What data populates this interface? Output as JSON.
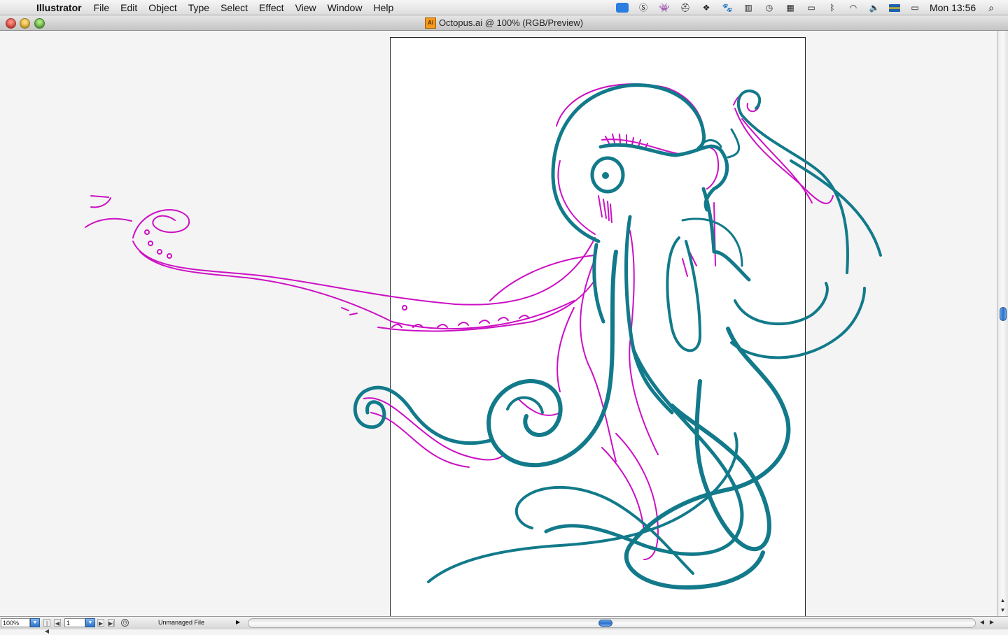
{
  "menubar": {
    "apple": "",
    "app_name": "Illustrator",
    "menus": [
      "File",
      "Edit",
      "Object",
      "Type",
      "Select",
      "Effect",
      "View",
      "Window",
      "Help"
    ],
    "clock": "Mon 13:56",
    "spotlight": "⌕"
  },
  "window": {
    "title": "Octopus.ai @ 100% (RGB/Preview)",
    "doc_icon_label": "Ai"
  },
  "statusbar": {
    "zoom": "100%",
    "page": "1",
    "status_text": "Unmanaged File",
    "first_page": "|◀",
    "prev_page": "◀",
    "next_page": "▶",
    "last_page": "▶|",
    "dropdown_glyph": "▼",
    "menu_arrow": "▶",
    "scroll_left": "◀",
    "scroll_right": "▶"
  },
  "scroll": {
    "up": "▲",
    "down": "▼"
  },
  "colors": {
    "teal": "#127a8a",
    "magenta": "#cc10c4"
  }
}
